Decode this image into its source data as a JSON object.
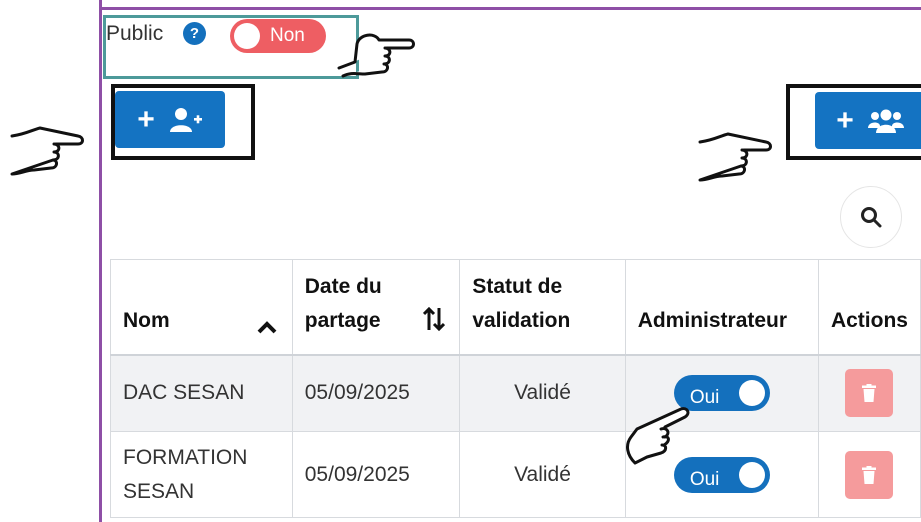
{
  "public": {
    "label": "Public",
    "help_icon": "?",
    "toggle_text": "Non"
  },
  "buttons": {
    "add_user_plus": "+",
    "add_group_plus": "+"
  },
  "table": {
    "headers": [
      "Nom",
      "Date du partage",
      "Statut de validation",
      "Administrateur",
      "Actions"
    ],
    "header_lines": {
      "date": [
        "Date du",
        "partage"
      ],
      "statut": [
        "Statut de",
        "validation"
      ]
    },
    "rows": [
      {
        "nom": "DAC SESAN",
        "date": "05/09/2025",
        "statut": "Validé",
        "admin": "Oui"
      },
      {
        "nom_lines": [
          "FORMATION",
          "SESAN"
        ],
        "date": "05/09/2025",
        "statut": "Validé",
        "admin": "Oui"
      }
    ]
  },
  "colors": {
    "accent_blue": "#1470bd",
    "toggle_off": "#ee5e63",
    "delete_button": "#f59b9c",
    "frame": "#8e4fa6"
  },
  "icons": [
    "help-icon",
    "user-plus-icon",
    "users-icon",
    "search-icon",
    "sort-up-icon",
    "sort-icon",
    "trash-icon",
    "pointing-hand-icon"
  ]
}
